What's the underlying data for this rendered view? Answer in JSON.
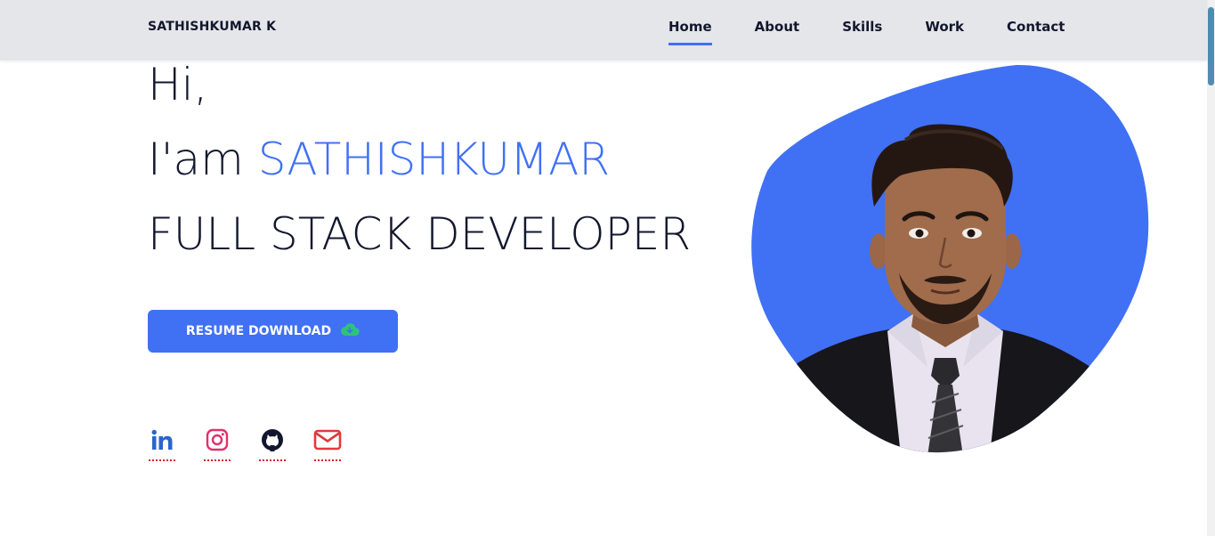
{
  "header": {
    "logo": "SATHISHKUMAR K",
    "nav": [
      {
        "label": "Home",
        "active": true
      },
      {
        "label": "About",
        "active": false
      },
      {
        "label": "Skills",
        "active": false
      },
      {
        "label": "Work",
        "active": false
      },
      {
        "label": "Contact",
        "active": false
      }
    ]
  },
  "hero": {
    "greeting": "Hi,",
    "intro_prefix": "I'am ",
    "name": "SATHISHKUMAR",
    "role": "FULL STACK DEVELOPER",
    "resume_button": "RESUME DOWNLOAD"
  },
  "social": [
    {
      "name": "linkedin-icon",
      "color": "#2a66c9"
    },
    {
      "name": "instagram-icon",
      "color": "#e1306c"
    },
    {
      "name": "github-icon",
      "color": "#12172d"
    },
    {
      "name": "email-icon",
      "color": "#e0393e"
    }
  ],
  "colors": {
    "accent": "#4070f4",
    "header_bg": "#e5e6ea",
    "text": "#12172d",
    "download_icon": "#2ec27e"
  }
}
